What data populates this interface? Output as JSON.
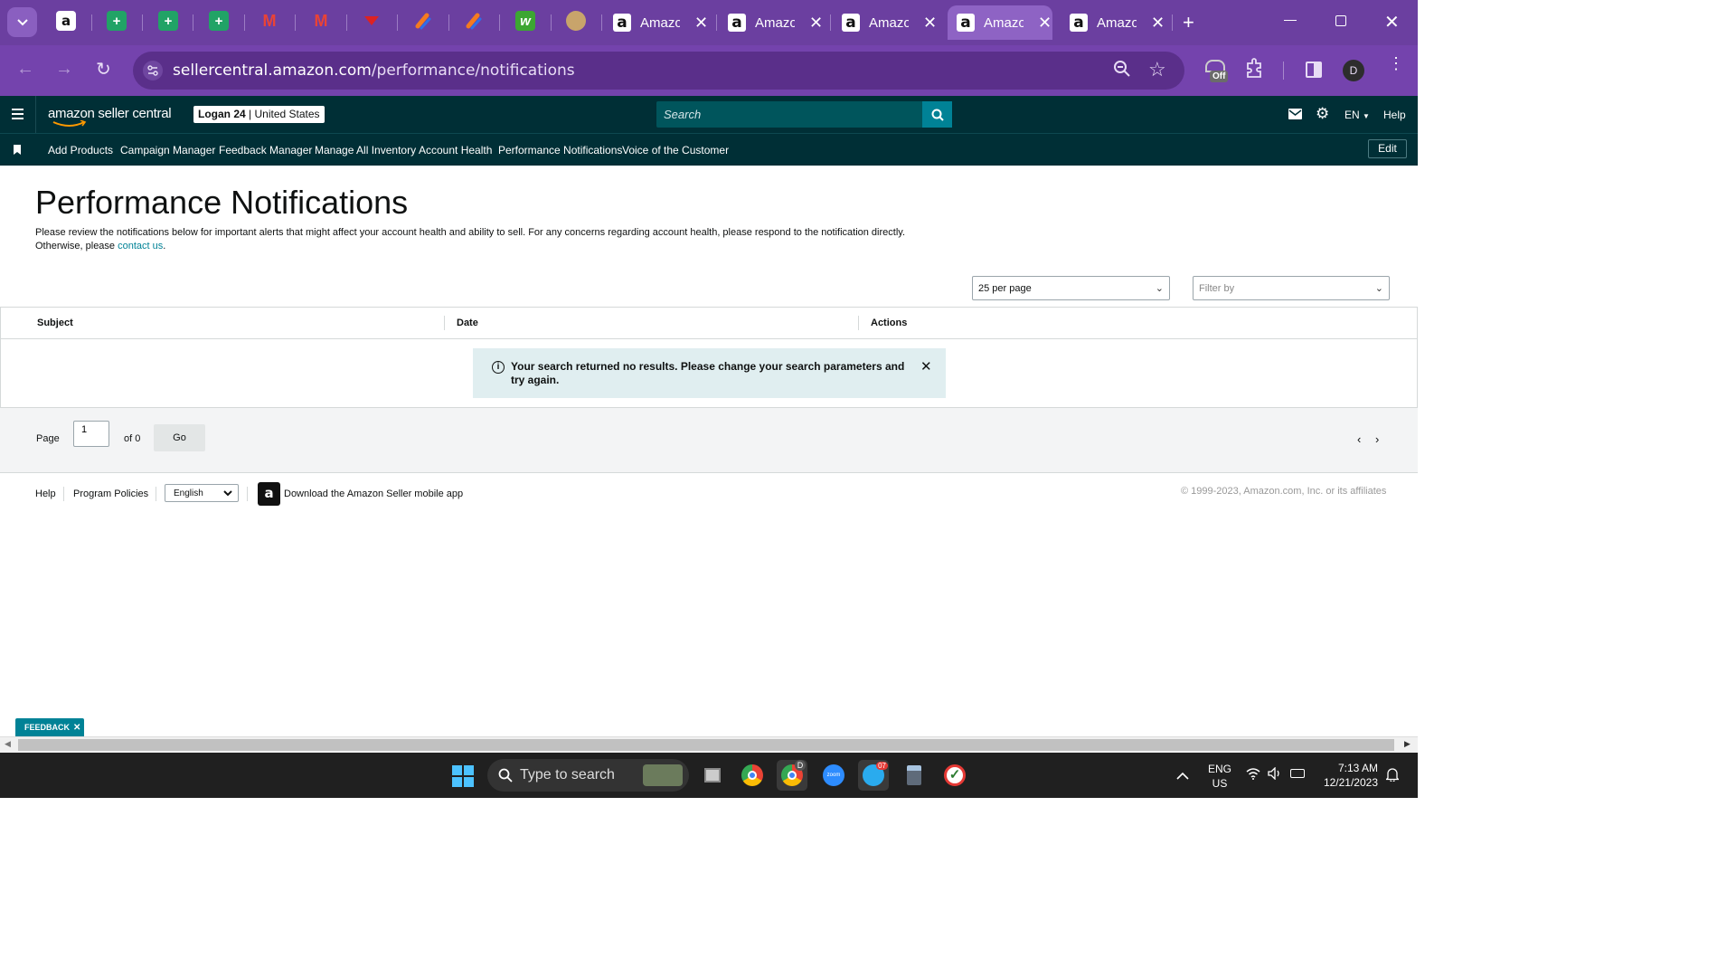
{
  "browser": {
    "tabs": [
      {
        "label": "Amazo"
      },
      {
        "label": "Amazo"
      },
      {
        "label": "Amazo"
      },
      {
        "label": "Amazo"
      },
      {
        "label": "Amazo"
      }
    ],
    "url_host": "sellercentral.amazon.com",
    "url_path": "/performance/notifications",
    "extension_badge": "Off",
    "profile_initial": "D"
  },
  "header": {
    "logo": "amazon seller central",
    "store_name": "Logan 24",
    "store_region": "United States",
    "search_placeholder": "Search",
    "language": "EN",
    "help": "Help"
  },
  "nav": {
    "items": [
      {
        "label": "Add Products"
      },
      {
        "label": "Campaign Manager"
      },
      {
        "label": "Feedback Manager"
      },
      {
        "label": "Manage All Inventory"
      },
      {
        "label": "Account Health"
      },
      {
        "label": "Performance Notifications"
      },
      {
        "label": "Voice of the Customer"
      }
    ],
    "edit": "Edit"
  },
  "main": {
    "title": "Performance Notifications",
    "desc_1": "Please review the notifications below for important alerts that might affect your account health and ability to sell. For any concerns regarding account health, please respond to the notification directly. Otherwise, please",
    "desc_link": "contact us",
    "desc_end": ".",
    "per_page": "25 per page",
    "filter_placeholder": "Filter by",
    "columns": [
      "Subject",
      "Date",
      "Actions"
    ],
    "alert": "Your search returned no results. Please change your search parameters and try again.",
    "pager": {
      "page_label": "Page",
      "page_value": "1",
      "of_label": "of 0",
      "go": "Go"
    }
  },
  "footer": {
    "help": "Help",
    "policies": "Program Policies",
    "language": "English",
    "app_link": "Download the Amazon Seller mobile app",
    "copyright": "© 1999-2023, Amazon.com, Inc. or its affiliates"
  },
  "feedback_tab": "FEEDBACK",
  "taskbar": {
    "search_placeholder": "Type to search",
    "lang_1": "ENG",
    "lang_2": "US",
    "time": "7:13 AM",
    "date": "12/21/2023",
    "telegram_badge": "07",
    "chrome_profile": "D"
  },
  "colors": {
    "header_bg": "#002f36",
    "accent": "#008296",
    "browser_purple": "#6b3fa0"
  }
}
